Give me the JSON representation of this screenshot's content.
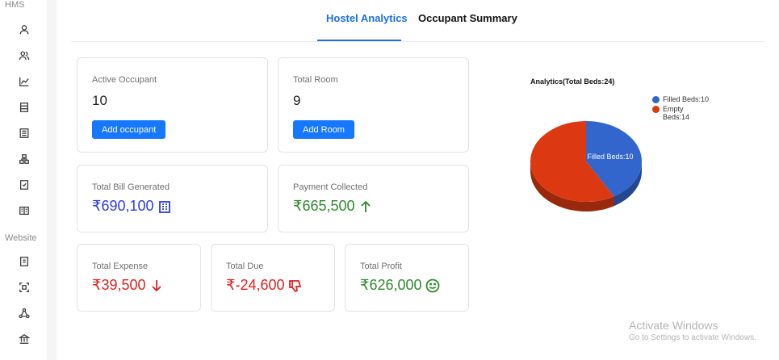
{
  "sidebar": {
    "section_app": "HMS",
    "section_website": "Website",
    "icons_top": [
      "user-icon",
      "users-icon",
      "line-chart-icon",
      "list-icon",
      "building-icon",
      "hierarchy-icon",
      "receipt-icon",
      "book-icon"
    ],
    "icons_bottom": [
      "file-icon",
      "scan-icon",
      "share-nodes-icon",
      "bank-icon"
    ]
  },
  "tabs": {
    "analytics": "Hostel Analytics",
    "summary": "Occupant Summary"
  },
  "cards": {
    "active_occupant": {
      "label": "Active Occupant",
      "value": "10",
      "button": "Add occupant"
    },
    "total_room": {
      "label": "Total Room",
      "value": "9",
      "button": "Add Room"
    },
    "total_bill": {
      "label": "Total Bill Generated",
      "value": "₹690,100",
      "icon": "building-icon",
      "color": "#2b3ce0"
    },
    "payment_collected": {
      "label": "Payment Collected",
      "value": "₹665,500",
      "icon": "arrow-up-icon",
      "color": "#2e8b2e"
    },
    "total_expense": {
      "label": "Total Expense",
      "value": "₹39,500",
      "icon": "arrow-down-icon",
      "color": "#e02020"
    },
    "total_due": {
      "label": "Total Due",
      "value": "₹-24,600",
      "icon": "thumbs-down-icon",
      "color": "#e02020"
    },
    "total_profit": {
      "label": "Total Profit",
      "value": "₹626,000",
      "icon": "smile-icon",
      "color": "#2e8b2e"
    }
  },
  "chart_data": {
    "type": "pie",
    "title": "Analytics(Total Beds:24)",
    "categories": [
      "Filled Beds:10",
      "Empty Beds:14"
    ],
    "values": [
      10,
      14
    ],
    "colors": [
      "#3366cc",
      "#dc3912"
    ],
    "slice_labels": [
      "Filled Beds:10",
      ""
    ],
    "legend_position": "right"
  },
  "watermark": {
    "title": "Activate Windows",
    "subtitle": "Go to Settings to activate Windows."
  }
}
